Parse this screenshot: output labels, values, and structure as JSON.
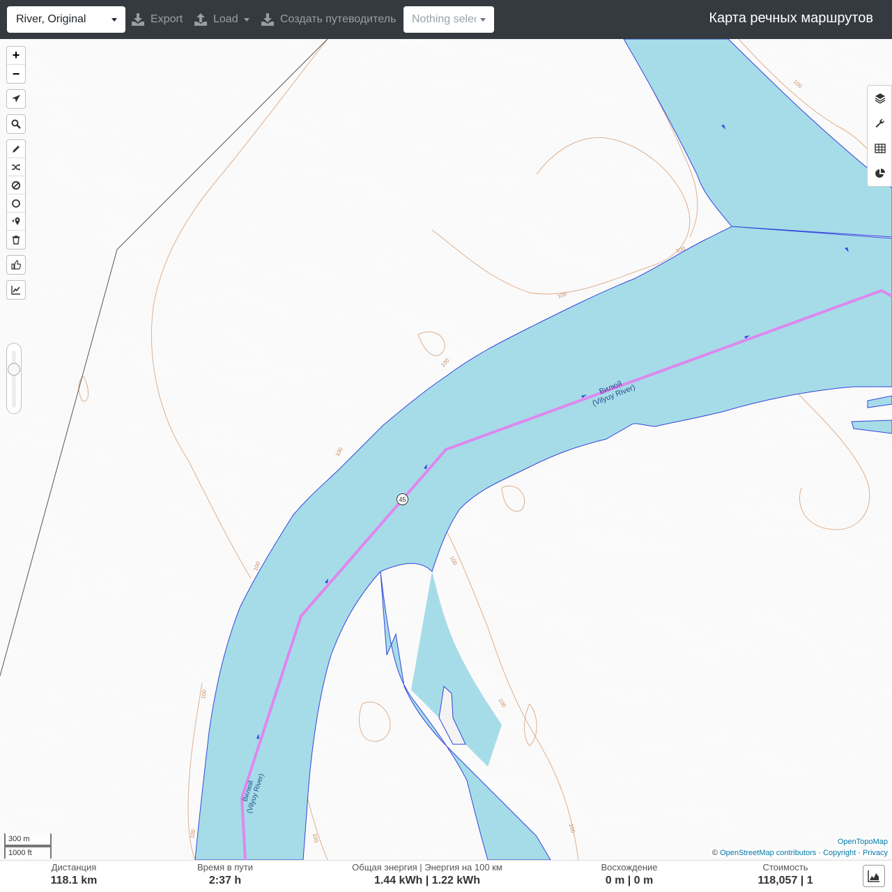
{
  "navbar": {
    "profile": "River, Original",
    "export_label": "Export",
    "load_label": "Load",
    "guide_label": "Создать путеводитель",
    "selection_placeholder": "Nothing selected",
    "brand": "Карта речных маршрутов"
  },
  "map": {
    "river_label_1": "Вилюй",
    "river_label_1b": "(Vilyuy River)",
    "river_label_2": "Вилюй",
    "river_label_2b": "(Vilyuy River)",
    "marker_number": "45",
    "contour_label": "100",
    "colors": {
      "water": "#a6dce8",
      "route": "#dd88ee",
      "contour": "#d9a27a",
      "shore": "#3344dd"
    }
  },
  "toolbar": {
    "zoom_in": "+",
    "zoom_out": "−"
  },
  "scale": {
    "metric": "300 m",
    "imperial": "1000 ft"
  },
  "attribution": {
    "top": "OpenTopoMap",
    "prefix": "©",
    "osm": "OpenStreetMap contributors",
    "sep1": "·",
    "copyright": "Copyright",
    "sep2": "·",
    "privacy": "Privacy"
  },
  "stats": {
    "distance_label": "Дистанция",
    "distance_value": "118.1 km",
    "time_label": "Время в пути",
    "time_value": "2:37 h",
    "energy_label": "Общая энергия | Энергия на 100 км",
    "energy_value": "1.44 kWh | 1.22 kWh",
    "ascent_label": "Восхождение",
    "ascent_value": "0 m | 0 m",
    "cost_label": "Стоимость",
    "cost_value": "118,057 | 1"
  }
}
